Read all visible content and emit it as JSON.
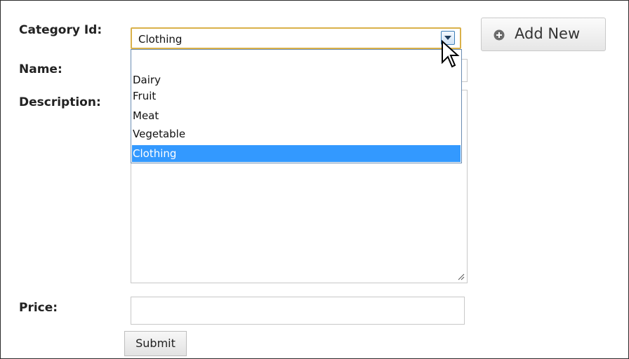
{
  "form": {
    "category_label": "Category Id:",
    "name_label": "Name:",
    "description_label": "Description:",
    "price_label": "Price:",
    "category_selected": "Clothing",
    "category_options": [
      "Dairy",
      "Fruit",
      "Meat",
      "Vegetable",
      "Clothing"
    ],
    "name_value": "",
    "description_value": "",
    "price_value": "",
    "submit_label": "Submit"
  },
  "actions": {
    "add_new_label": "Add New",
    "add_new_icon": "plus-circle-icon"
  },
  "colors": {
    "selected_option_bg": "#3399ff",
    "focus_border": "#d9b14a"
  }
}
